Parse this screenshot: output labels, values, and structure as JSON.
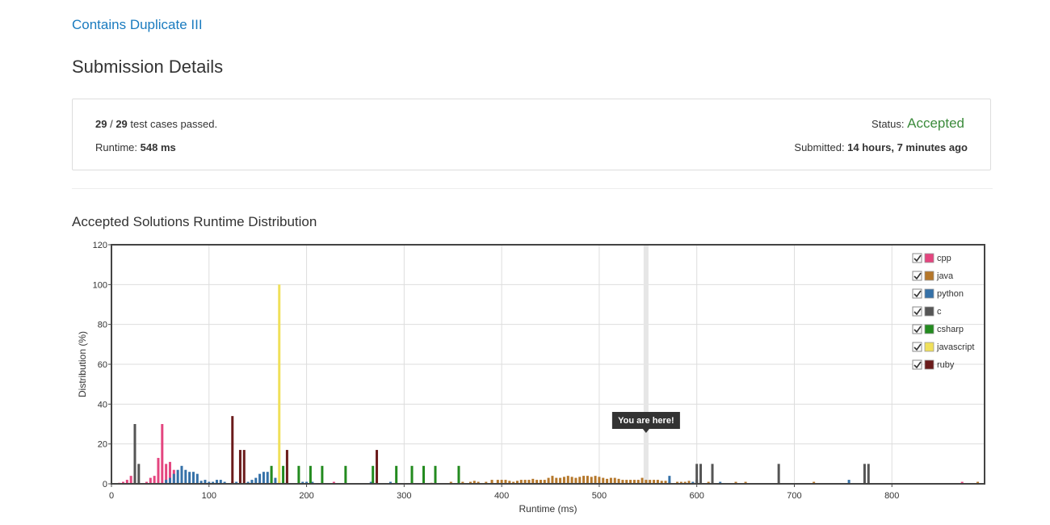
{
  "problem": {
    "title": "Contains Duplicate III"
  },
  "page": {
    "title": "Submission Details"
  },
  "details": {
    "passed": "29",
    "separator": " / ",
    "total": "29",
    "passed_suffix": " test cases passed.",
    "runtime_label": "Runtime: ",
    "runtime_value": "548 ms",
    "status_label": "Status: ",
    "status_value": "Accepted",
    "submitted_label": "Submitted: ",
    "submitted_value": "14 hours, 7 minutes ago"
  },
  "chart_heading": "Accepted Solutions Runtime Distribution",
  "chart_data": {
    "type": "bar",
    "xlabel": "Runtime (ms)",
    "ylabel": "Distribution (%)",
    "xlim": [
      0,
      895
    ],
    "ylim": [
      0,
      120
    ],
    "x_ticks": [
      0,
      100,
      200,
      300,
      400,
      500,
      600,
      700,
      800
    ],
    "y_ticks": [
      0,
      20,
      40,
      60,
      80,
      100,
      120
    ],
    "grid": true,
    "legend_position": "top-right",
    "marker": {
      "x": 548,
      "label": "You are here!"
    },
    "series": [
      {
        "name": "cpp",
        "color": "#e4457f",
        "checked": true,
        "points": [
          [
            8,
            0.5
          ],
          [
            12,
            1
          ],
          [
            16,
            2
          ],
          [
            20,
            4
          ],
          [
            24,
            6
          ],
          [
            36,
            1
          ],
          [
            40,
            3
          ],
          [
            44,
            4
          ],
          [
            48,
            13
          ],
          [
            52,
            30
          ],
          [
            56,
            10
          ],
          [
            60,
            11
          ],
          [
            64,
            7
          ],
          [
            152,
            1
          ],
          [
            228,
            1
          ],
          [
            872,
            1
          ]
        ]
      },
      {
        "name": "java",
        "color": "#b5772a",
        "checked": true,
        "points": [
          [
            328,
            0.5
          ],
          [
            348,
            1
          ],
          [
            360,
            1
          ],
          [
            368,
            1
          ],
          [
            372,
            1.5
          ],
          [
            376,
            1
          ],
          [
            384,
            1
          ],
          [
            390,
            2
          ],
          [
            396,
            2
          ],
          [
            400,
            2
          ],
          [
            404,
            2
          ],
          [
            408,
            1.5
          ],
          [
            412,
            1
          ],
          [
            416,
            1.5
          ],
          [
            420,
            2
          ],
          [
            424,
            2
          ],
          [
            428,
            2
          ],
          [
            432,
            2.5
          ],
          [
            436,
            2
          ],
          [
            440,
            2
          ],
          [
            444,
            2
          ],
          [
            448,
            3
          ],
          [
            452,
            4
          ],
          [
            456,
            3
          ],
          [
            460,
            3
          ],
          [
            464,
            3.5
          ],
          [
            468,
            4
          ],
          [
            472,
            3.5
          ],
          [
            476,
            3
          ],
          [
            480,
            3.5
          ],
          [
            484,
            4
          ],
          [
            488,
            4
          ],
          [
            492,
            3.5
          ],
          [
            496,
            4
          ],
          [
            500,
            3.5
          ],
          [
            504,
            3
          ],
          [
            508,
            2.5
          ],
          [
            512,
            3
          ],
          [
            516,
            3
          ],
          [
            520,
            2.5
          ],
          [
            524,
            2
          ],
          [
            528,
            2
          ],
          [
            532,
            2
          ],
          [
            536,
            2
          ],
          [
            540,
            2
          ],
          [
            544,
            3
          ],
          [
            548,
            2
          ],
          [
            552,
            2
          ],
          [
            556,
            2
          ],
          [
            560,
            2
          ],
          [
            564,
            1.5
          ],
          [
            568,
            1.5
          ],
          [
            572,
            1
          ],
          [
            580,
            1
          ],
          [
            584,
            1
          ],
          [
            588,
            1
          ],
          [
            592,
            1.5
          ],
          [
            596,
            1
          ],
          [
            600,
            1
          ],
          [
            604,
            1
          ],
          [
            612,
            1
          ],
          [
            616,
            1
          ],
          [
            640,
            1
          ],
          [
            650,
            1
          ],
          [
            720,
            1
          ],
          [
            888,
            1
          ]
        ]
      },
      {
        "name": "python",
        "color": "#3571a8",
        "checked": true,
        "points": [
          [
            56,
            2
          ],
          [
            60,
            3
          ],
          [
            64,
            5
          ],
          [
            68,
            7
          ],
          [
            72,
            9
          ],
          [
            76,
            7
          ],
          [
            80,
            6
          ],
          [
            84,
            6
          ],
          [
            88,
            5
          ],
          [
            92,
            1.5
          ],
          [
            96,
            2
          ],
          [
            100,
            1
          ],
          [
            104,
            1
          ],
          [
            108,
            2
          ],
          [
            112,
            2
          ],
          [
            116,
            1
          ],
          [
            128,
            1
          ],
          [
            140,
            1
          ],
          [
            144,
            2
          ],
          [
            148,
            3
          ],
          [
            152,
            5
          ],
          [
            156,
            6
          ],
          [
            160,
            6
          ],
          [
            164,
            7
          ],
          [
            168,
            3
          ],
          [
            172,
            1
          ],
          [
            180,
            1
          ],
          [
            196,
            1
          ],
          [
            200,
            1
          ],
          [
            206,
            1
          ],
          [
            266,
            1
          ],
          [
            286,
            1
          ],
          [
            572,
            4
          ],
          [
            596,
            1
          ],
          [
            600,
            2
          ],
          [
            624,
            1
          ],
          [
            756,
            2
          ]
        ]
      },
      {
        "name": "c",
        "color": "#555555",
        "checked": true,
        "points": [
          [
            24,
            30
          ],
          [
            28,
            10
          ],
          [
            124,
            1
          ],
          [
            600,
            10
          ],
          [
            604,
            10
          ],
          [
            616,
            10
          ],
          [
            684,
            10
          ],
          [
            772,
            10
          ],
          [
            776,
            10
          ]
        ]
      },
      {
        "name": "csharp",
        "color": "#238b1f",
        "checked": true,
        "points": [
          [
            164,
            9
          ],
          [
            176,
            9
          ],
          [
            192,
            9
          ],
          [
            204,
            9
          ],
          [
            216,
            9
          ],
          [
            240,
            9
          ],
          [
            268,
            9
          ],
          [
            292,
            9
          ],
          [
            308,
            9
          ],
          [
            320,
            9
          ],
          [
            332,
            9
          ],
          [
            356,
            9
          ]
        ]
      },
      {
        "name": "javascript",
        "color": "#f0e05a",
        "checked": true,
        "points": [
          [
            172,
            100
          ]
        ]
      },
      {
        "name": "ruby",
        "color": "#6b1b1b",
        "checked": true,
        "points": [
          [
            124,
            34
          ],
          [
            132,
            17
          ],
          [
            136,
            17
          ],
          [
            180,
            17
          ],
          [
            272,
            17
          ]
        ]
      }
    ]
  }
}
